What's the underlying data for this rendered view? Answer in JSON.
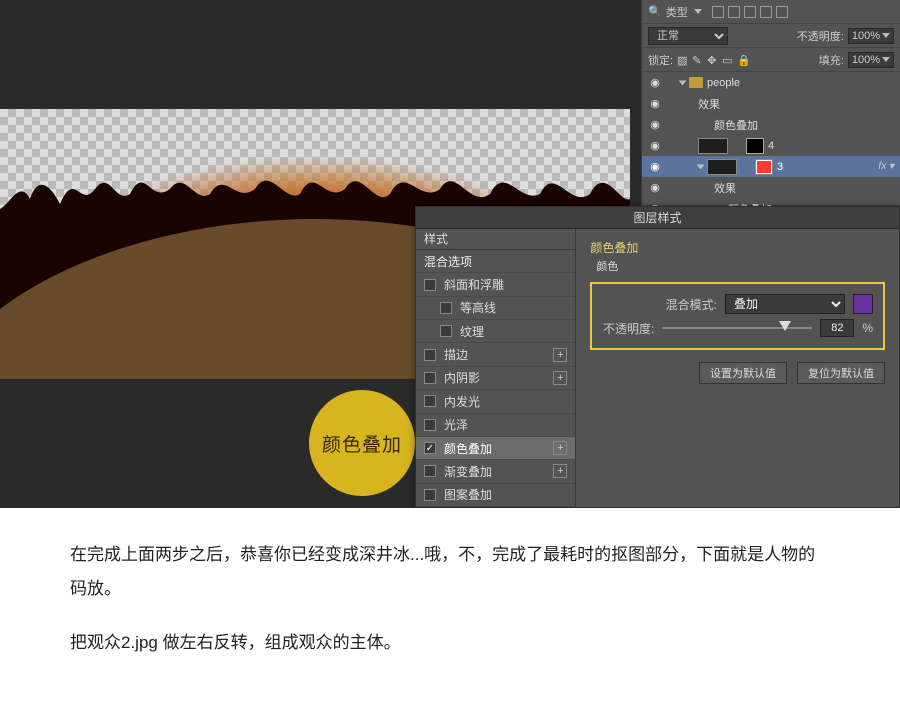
{
  "layersPanel": {
    "typeSearch": "类型",
    "blendMode": "正常",
    "opacityLabel": "不透明度:",
    "opacityValue": "100%",
    "lockLabel": "锁定:",
    "fillLabel": "填充:",
    "fillValue": "100%",
    "group": {
      "name": "people"
    },
    "effectsLabel": "效果",
    "colorOverlayLabel": "颜色叠加",
    "layer4": "4",
    "layer3": "3"
  },
  "badge": {
    "label": "颜色叠加"
  },
  "layerStyle": {
    "dialogTitle": "图层样式",
    "leftHeader": "样式",
    "blendingOptions": "混合选项",
    "items": {
      "bevel": "斜面和浮雕",
      "contour": "等高线",
      "texture": "纹理",
      "stroke": "描边",
      "innerShadow": "内阴影",
      "innerGlow": "内发光",
      "satin": "光泽",
      "colorOverlay": "颜色叠加",
      "gradientOverlay": "渐变叠加",
      "patternOverlay": "图案叠加"
    },
    "right": {
      "section": "颜色叠加",
      "colorLabel": "颜色",
      "blendModeLabel": "混合模式:",
      "blendModeValue": "叠加",
      "opacityLabel": "不透明度:",
      "opacityValue": "82",
      "opacityPct": 82,
      "swatchColor": "#6b2fa3",
      "pctSign": "%",
      "btnDefault": "设置为默认值",
      "btnReset": "复位为默认值"
    }
  },
  "article": {
    "p1": "在完成上面两步之后，恭喜你已经变成深井冰...哦，不，完成了最耗时的抠图部分，下面就是人物的码放。",
    "p2": "把观众2.jpg 做左右反转，组成观众的主体。"
  }
}
